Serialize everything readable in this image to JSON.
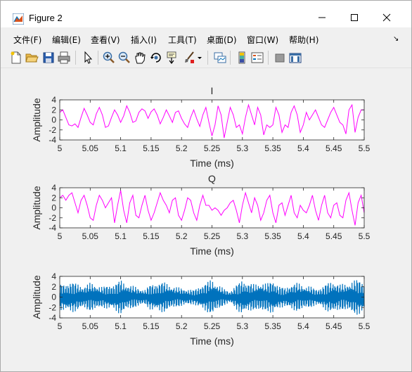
{
  "window": {
    "title": "Figure 2"
  },
  "menu": [
    "文件(F)",
    "编辑(E)",
    "查看(V)",
    "插入(I)",
    "工具(T)",
    "桌面(D)",
    "窗口(W)",
    "帮助(H)"
  ],
  "menu_arrow": "↘",
  "toolbar_icons": [
    "new-figure-icon",
    "open-file-icon",
    "save-icon",
    "print-icon",
    "pointer-icon",
    "zoom-in-icon",
    "zoom-out-icon",
    "pan-icon",
    "rotate-3d-icon",
    "data-cursor-icon",
    "brush-icon",
    "brush-dropdown-icon",
    "link-plot-icon",
    "insert-colorbar-icon",
    "insert-legend-icon",
    "hide-plot-tools-icon",
    "show-plot-tools-icon"
  ],
  "colors": {
    "magenta": "#ff00ff",
    "blue": "#0072bd",
    "axis": "#262626"
  },
  "chart_data": [
    {
      "type": "line",
      "title": "I",
      "xlabel": "Time (ms)",
      "ylabel": "Amplitude",
      "xlim": [
        5,
        5.5
      ],
      "ylim": [
        -4,
        4
      ],
      "xticks": [
        "5",
        "5.05",
        "5.1",
        "5.15",
        "5.2",
        "5.25",
        "5.3",
        "5.35",
        "5.4",
        "5.45",
        "5.5"
      ],
      "yticks": [
        "4",
        "2",
        "0",
        "-2",
        "-4"
      ],
      "series": [
        {
          "color": "#ff00ff",
          "x": [
            5.0,
            5.005,
            5.01,
            5.015,
            5.02,
            5.025,
            5.03,
            5.035,
            5.04,
            5.045,
            5.05,
            5.055,
            5.06,
            5.065,
            5.07,
            5.075,
            5.08,
            5.085,
            5.09,
            5.095,
            5.1,
            5.105,
            5.11,
            5.115,
            5.12,
            5.125,
            5.13,
            5.135,
            5.14,
            5.145,
            5.15,
            5.155,
            5.16,
            5.165,
            5.17,
            5.175,
            5.18,
            5.185,
            5.19,
            5.195,
            5.2,
            5.205,
            5.21,
            5.215,
            5.22,
            5.225,
            5.23,
            5.235,
            5.24,
            5.245,
            5.25,
            5.255,
            5.26,
            5.265,
            5.27,
            5.275,
            5.28,
            5.285,
            5.29,
            5.295,
            5.3,
            5.305,
            5.31,
            5.315,
            5.32,
            5.325,
            5.33,
            5.335,
            5.34,
            5.345,
            5.35,
            5.355,
            5.36,
            5.365,
            5.37,
            5.375,
            5.38,
            5.385,
            5.39,
            5.395,
            5.4,
            5.405,
            5.41,
            5.415,
            5.42,
            5.425,
            5.43,
            5.435,
            5.44,
            5.445,
            5.45,
            5.455,
            5.46,
            5.465,
            5.47,
            5.475,
            5.48,
            5.485,
            5.49,
            5.495,
            5.5
          ],
          "y": [
            1.5,
            2.0,
            0.5,
            -1.0,
            -1.2,
            -0.8,
            -1.5,
            0.5,
            2.3,
            1.0,
            -0.5,
            -1.0,
            1.2,
            2.5,
            1.0,
            -1.5,
            -1.2,
            0.5,
            2.0,
            1.0,
            -0.5,
            0.8,
            2.8,
            1.5,
            -0.5,
            -0.2,
            1.5,
            2.2,
            1.8,
            0.3,
            1.6,
            2.2,
            1.0,
            -0.8,
            0.5,
            2.0,
            0.8,
            -0.5,
            1.5,
            1.8,
            0.3,
            -0.8,
            -1.5,
            0.5,
            2.0,
            0.2,
            -1.3,
            1.0,
            2.5,
            -0.5,
            -3.2,
            -1.0,
            2.8,
            1.0,
            -3.6,
            -0.5,
            2.5,
            1.0,
            -1.5,
            -1.0,
            -2.8,
            0.5,
            3.0,
            1.0,
            -1.0,
            2.5,
            1.0,
            -3.0,
            -1.0,
            -1.5,
            -1.0,
            2.5,
            1.0,
            -2.5,
            -1.0,
            -1.5,
            1.5,
            2.8,
            1.0,
            -2.5,
            -1.0,
            1.5,
            0.0,
            1.0,
            2.0,
            0.5,
            -1.0,
            -1.5,
            0.0,
            1.5,
            2.5,
            1.0,
            -0.5,
            -1.0,
            -2.8,
            2.0,
            3.0,
            -2.5,
            0.5,
            2.0,
            2.0
          ]
        }
      ]
    },
    {
      "type": "line",
      "title": "Q",
      "xlabel": "Time (ms)",
      "ylabel": "Amplitude",
      "xlim": [
        5,
        5.5
      ],
      "ylim": [
        -4,
        4
      ],
      "xticks": [
        "5",
        "5.05",
        "5.1",
        "5.15",
        "5.2",
        "5.25",
        "5.3",
        "5.35",
        "5.4",
        "5.45",
        "5.5"
      ],
      "yticks": [
        "4",
        "2",
        "0",
        "-2",
        "-4"
      ],
      "series": [
        {
          "color": "#ff00ff",
          "x": [
            5.0,
            5.005,
            5.01,
            5.015,
            5.02,
            5.025,
            5.03,
            5.035,
            5.04,
            5.045,
            5.05,
            5.055,
            5.06,
            5.065,
            5.07,
            5.075,
            5.08,
            5.085,
            5.09,
            5.095,
            5.1,
            5.105,
            5.11,
            5.115,
            5.12,
            5.125,
            5.13,
            5.135,
            5.14,
            5.145,
            5.15,
            5.155,
            5.16,
            5.165,
            5.17,
            5.175,
            5.18,
            5.185,
            5.19,
            5.195,
            5.2,
            5.205,
            5.21,
            5.215,
            5.22,
            5.225,
            5.23,
            5.235,
            5.24,
            5.245,
            5.25,
            5.255,
            5.26,
            5.265,
            5.27,
            5.275,
            5.28,
            5.285,
            5.29,
            5.295,
            5.3,
            5.305,
            5.31,
            5.315,
            5.32,
            5.325,
            5.33,
            5.335,
            5.34,
            5.345,
            5.35,
            5.355,
            5.36,
            5.365,
            5.37,
            5.375,
            5.38,
            5.385,
            5.39,
            5.395,
            5.4,
            5.405,
            5.41,
            5.415,
            5.42,
            5.425,
            5.43,
            5.435,
            5.44,
            5.445,
            5.45,
            5.455,
            5.46,
            5.465,
            5.47,
            5.475,
            5.48,
            5.485,
            5.49,
            5.495,
            5.5
          ],
          "y": [
            2.0,
            2.5,
            1.5,
            2.5,
            3.0,
            1.0,
            -1.0,
            1.5,
            2.5,
            0.5,
            -2.0,
            -2.5,
            0.5,
            2.5,
            1.5,
            0.0,
            1.0,
            2.0,
            -3.0,
            0.5,
            3.5,
            -0.5,
            -3.0,
            1.0,
            2.5,
            -1.5,
            -2.0,
            0.5,
            2.5,
            -0.5,
            -2.5,
            -1.0,
            1.0,
            3.0,
            1.5,
            0.5,
            -1.0,
            1.5,
            2.0,
            -1.5,
            -2.5,
            -0.5,
            2.0,
            1.5,
            -1.0,
            -2.5,
            0.5,
            2.5,
            0.5,
            0.5,
            -0.5,
            0.0,
            -0.5,
            -1.5,
            -0.5,
            0.0,
            1.0,
            1.5,
            -0.5,
            -3.0,
            0.5,
            3.0,
            1.0,
            -1.0,
            2.0,
            0.5,
            -2.5,
            -1.0,
            1.5,
            2.5,
            -1.0,
            -3.0,
            0.5,
            1.0,
            -1.5,
            0.5,
            2.5,
            -1.0,
            -2.0,
            0.5,
            -0.5,
            -1.0,
            0.5,
            2.5,
            -0.5,
            -2.5,
            0.5,
            2.5,
            -1.0,
            -2.0,
            0.5,
            1.0,
            -1.5,
            -2.0,
            1.5,
            3.0,
            -0.5,
            -3.5,
            1.0,
            2.5,
            -1.0
          ]
        }
      ]
    },
    {
      "type": "line",
      "title": "",
      "xlabel": "Time (ms)",
      "ylabel": "Amplitude",
      "xlim": [
        5,
        5.5
      ],
      "ylim": [
        -4,
        4
      ],
      "xticks": [
        "5",
        "5.05",
        "5.1",
        "5.15",
        "5.2",
        "5.25",
        "5.3",
        "5.35",
        "5.4",
        "5.45",
        "5.5"
      ],
      "yticks": [
        "4",
        "2",
        "0",
        "-2",
        "-4"
      ],
      "series": [
        {
          "color": "#0072bd",
          "x": [
            5.0,
            5.01,
            5.02,
            5.03,
            5.04,
            5.05,
            5.06,
            5.07,
            5.08,
            5.09,
            5.1,
            5.11,
            5.12,
            5.13,
            5.14,
            5.15,
            5.16,
            5.17,
            5.18,
            5.19,
            5.2,
            5.21,
            5.22,
            5.23,
            5.24,
            5.25,
            5.26,
            5.27,
            5.28,
            5.29,
            5.3,
            5.31,
            5.32,
            5.33,
            5.34,
            5.35,
            5.36,
            5.37,
            5.38,
            5.39,
            5.4,
            5.41,
            5.42,
            5.43,
            5.44,
            5.45,
            5.46,
            5.47,
            5.48,
            5.49,
            5.5
          ],
          "envelope": [
            2.5,
            2.8,
            3.0,
            2.6,
            2.2,
            2.8,
            2.5,
            2.0,
            2.4,
            2.6,
            3.4,
            2.6,
            2.2,
            1.8,
            1.5,
            2.6,
            2.8,
            3.0,
            2.5,
            2.0,
            1.8,
            1.6,
            1.4,
            2.2,
            2.8,
            3.5,
            2.5,
            1.6,
            1.2,
            2.4,
            3.5,
            2.8,
            2.5,
            3.0,
            2.6,
            3.5,
            2.2,
            1.8,
            2.6,
            2.8,
            2.4,
            2.2,
            1.6,
            2.0,
            2.8,
            3.2,
            2.5,
            2.6,
            3.2,
            3.5,
            3.0
          ]
        }
      ]
    }
  ]
}
